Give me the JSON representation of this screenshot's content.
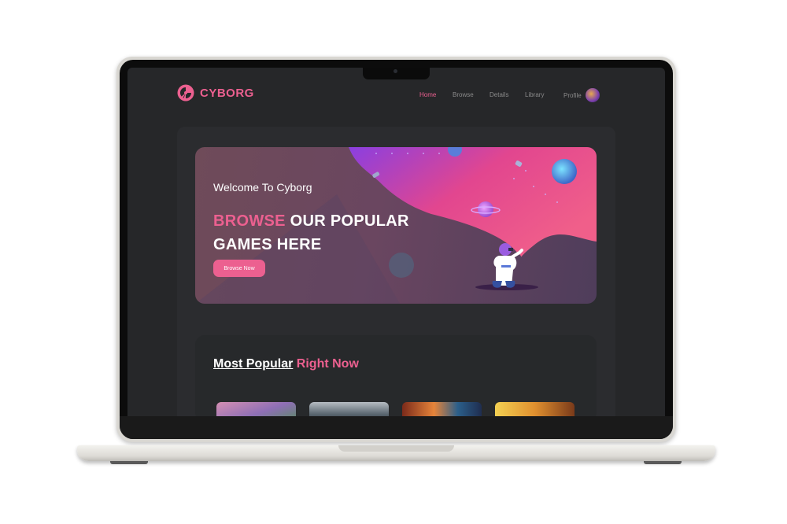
{
  "brand": {
    "name": "CYBORG",
    "color": "#ec6090"
  },
  "nav": {
    "items": [
      "Home",
      "Browse",
      "Details",
      "Library"
    ],
    "active": "Home",
    "profile_label": "Profile"
  },
  "hero": {
    "welcome": "Welcome To Cyborg",
    "headline_accent": "BROWSE",
    "headline_rest": "OUR POPULAR",
    "headline_line2": "GAMES HERE",
    "button_label": "Browse Now"
  },
  "popular": {
    "title_main": "Most Popular",
    "title_accent": "Right Now"
  },
  "colors": {
    "accent": "#ec6090",
    "background": "#262729",
    "panel": "#2b2c2f"
  }
}
